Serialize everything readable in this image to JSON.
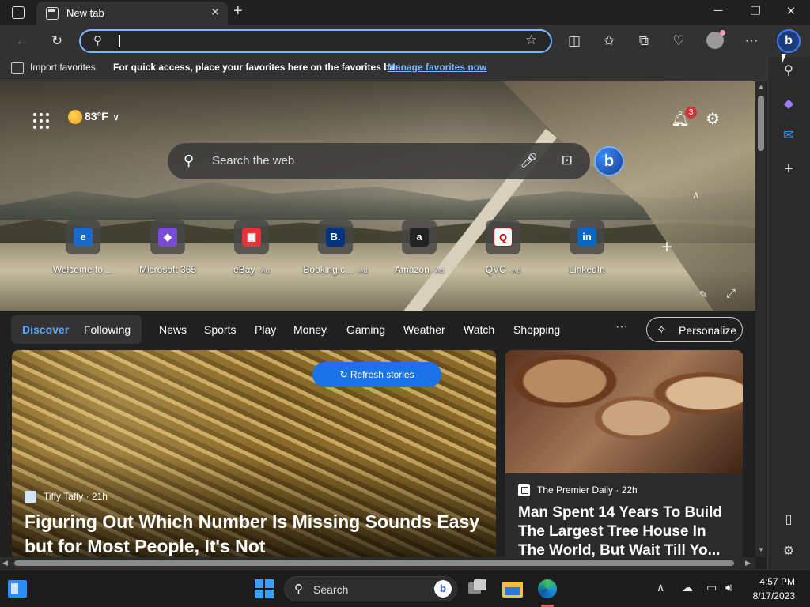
{
  "browser": {
    "tab_title": "New tab",
    "address_placeholder": "",
    "favorites_bar": {
      "import_label": "Import favorites",
      "message": "For quick access, place your favorites here on the favorites bar.",
      "manage_link": "Manage favorites now"
    },
    "window_controls": {
      "minimize": "─",
      "restore": "❐",
      "close": "✕"
    }
  },
  "newtab": {
    "weather": {
      "temp": "83°F"
    },
    "notifications_count": "3",
    "search_placeholder": "Search the web",
    "quick_links": [
      {
        "label": "Welcome to ...",
        "ad": "",
        "icon": "edge-icon",
        "bg": "#1b6ac9",
        "glyph": "e"
      },
      {
        "label": "Microsoft 365",
        "ad": "",
        "icon": "m365-icon",
        "bg": "#7b4bd8",
        "glyph": "◆"
      },
      {
        "label": "eBay",
        "ad": "· Ad",
        "icon": "ebay-icon",
        "bg": "#e53238",
        "glyph": "▦"
      },
      {
        "label": "Booking.c...",
        "ad": "· Ad",
        "icon": "booking-icon",
        "bg": "#003580",
        "glyph": "B."
      },
      {
        "label": "Amazon",
        "ad": "· Ad",
        "icon": "amazon-icon",
        "bg": "#222222",
        "glyph": "a"
      },
      {
        "label": "QVC",
        "ad": "· Ad",
        "icon": "qvc-icon",
        "bg": "#ffffff",
        "glyph": "Q"
      },
      {
        "label": "LinkedIn",
        "ad": "",
        "icon": "linkedin-icon",
        "bg": "#0a66c2",
        "glyph": "in"
      }
    ],
    "feed_tabs": {
      "discover": "Discover",
      "following": "Following",
      "items": [
        "News",
        "Sports",
        "Play",
        "Money",
        "Gaming",
        "Weather",
        "Watch",
        "Shopping"
      ],
      "more": "···",
      "personalize": "Personalize"
    },
    "refresh_label": "Refresh stories",
    "cards": [
      {
        "source": "Tiffy Taffy · 21h",
        "headline": "Figuring Out Which Number Is Missing Sounds Easy but for Most People, It's Not"
      },
      {
        "source": "The Premier Daily · 22h",
        "headline": "Man Spent 14 Years To Build The Largest Tree House In The World, But Wait Till Yo..."
      }
    ]
  },
  "taskbar": {
    "search_label": "Search",
    "time": "4:57 PM",
    "date": "8/17/2023"
  },
  "colors": {
    "accent": "#1a73e8",
    "link": "#7cb7ff",
    "badge": "#d13438"
  }
}
